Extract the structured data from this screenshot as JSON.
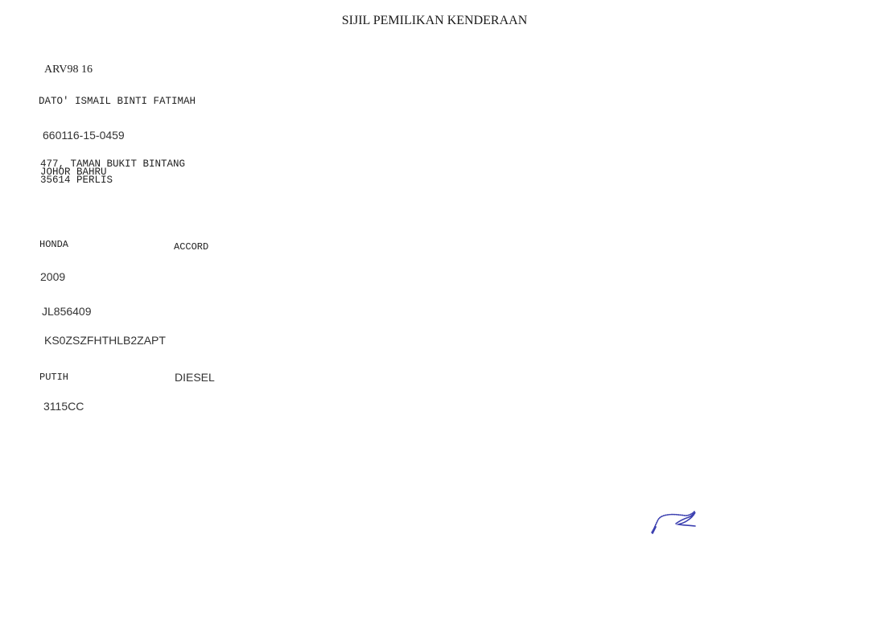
{
  "document": {
    "title": "SIJIL PEMILIKAN KENDERAAN"
  },
  "registration": {
    "plate_number": "ARV98 16"
  },
  "owner": {
    "name": "DATO' ISMAIL BINTI FATIMAH",
    "ic_number": "660116-15-0459",
    "address_line1": "477, TAMAN BUKIT BINTANG",
    "address_line2": "JOHOR BAHRU",
    "address_line3": "35614 PERLIS"
  },
  "vehicle": {
    "make": "HONDA",
    "model": "ACCORD",
    "year": "2009",
    "engine_number": "JL856409",
    "chassis_number": "KS0ZSZFHTHLB2ZAPT",
    "color": "PUTIH",
    "fuel_type": "DIESEL",
    "engine_capacity": "3115CC"
  },
  "signature": {
    "ink_color": "#3b3fb0"
  }
}
